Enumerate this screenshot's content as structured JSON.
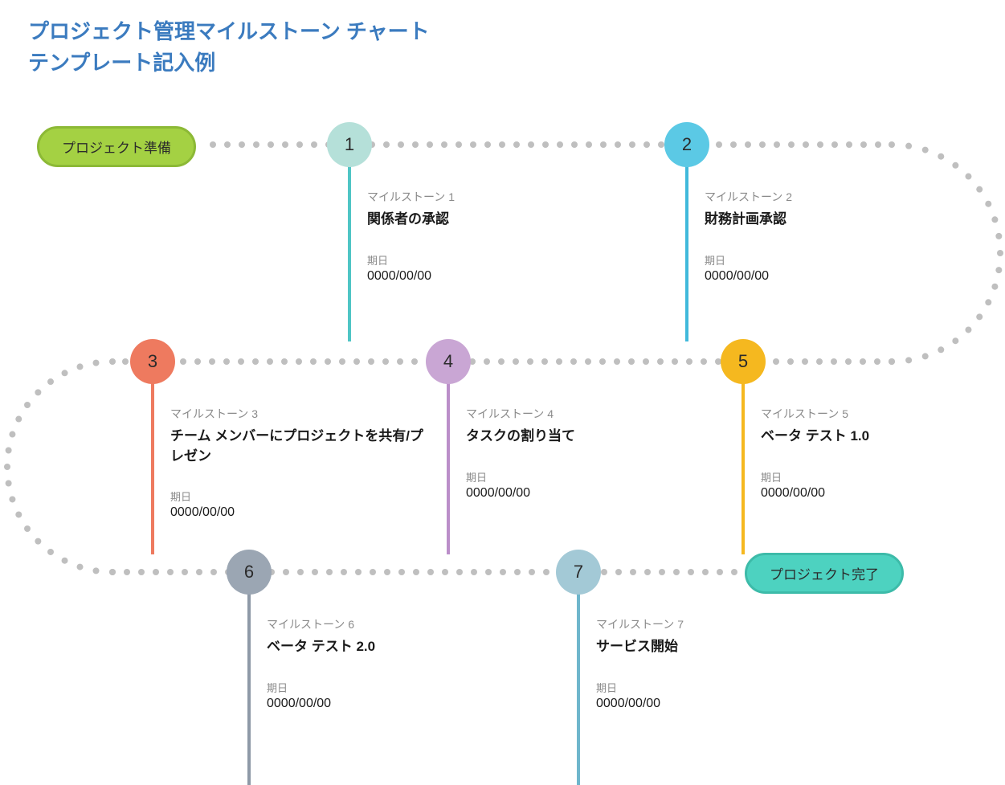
{
  "title_line1": "プロジェクト管理マイルストーン チャート",
  "title_line2": "テンプレート記入例",
  "start_pill": "プロジェクト準備",
  "end_pill": "プロジェクト完了",
  "date_label": "期日",
  "milestones": [
    {
      "num": "1",
      "label": "マイルストーン 1",
      "title": "関係者の承認",
      "date": "0000/00/00",
      "color": "#b5e0d9",
      "stem": "#4fc5c5"
    },
    {
      "num": "2",
      "label": "マイルストーン 2",
      "title": "財務計画承認",
      "date": "0000/00/00",
      "color": "#5bc9e5",
      "stem": "#40b9db"
    },
    {
      "num": "3",
      "label": "マイルストーン 3",
      "title": "チーム メンバーにプロジェクトを共有/プレゼン",
      "date": "0000/00/00",
      "color": "#ee7a5f",
      "stem": "#ee7a5f"
    },
    {
      "num": "4",
      "label": "マイルストーン 4",
      "title": "タスクの割り当て",
      "date": "0000/00/00",
      "color": "#c9a6d4",
      "stem": "#bb8ec9"
    },
    {
      "num": "5",
      "label": "マイルストーン 5",
      "title": "ベータ テスト 1.0",
      "date": "0000/00/00",
      "color": "#f5b81f",
      "stem": "#f5b81f"
    },
    {
      "num": "6",
      "label": "マイルストーン 6",
      "title": "ベータ テスト 2.0",
      "date": "0000/00/00",
      "color": "#9ba6b3",
      "stem": "#8e99a7"
    },
    {
      "num": "7",
      "label": "マイルストーン 7",
      "title": "サービス開始",
      "date": "0000/00/00",
      "color": "#a3c9d6",
      "stem": "#6fb6cc"
    }
  ],
  "chart_data": {
    "type": "timeline",
    "start": "プロジェクト準備",
    "end": "プロジェクト完了",
    "milestones": [
      {
        "order": 1,
        "name": "関係者の承認",
        "date": "0000/00/00"
      },
      {
        "order": 2,
        "name": "財務計画承認",
        "date": "0000/00/00"
      },
      {
        "order": 3,
        "name": "チーム メンバーにプロジェクトを共有/プレゼン",
        "date": "0000/00/00"
      },
      {
        "order": 4,
        "name": "タスクの割り当て",
        "date": "0000/00/00"
      },
      {
        "order": 5,
        "name": "ベータ テスト 1.0",
        "date": "0000/00/00"
      },
      {
        "order": 6,
        "name": "ベータ テスト 2.0",
        "date": "0000/00/00"
      },
      {
        "order": 7,
        "name": "サービス開始",
        "date": "0000/00/00"
      }
    ]
  }
}
